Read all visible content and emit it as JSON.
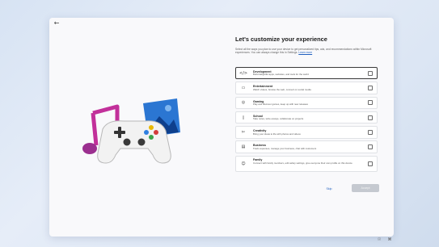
{
  "dialog": {
    "back_icon": "arrow-left-icon",
    "title": "Let's customize your experience",
    "description": "Select all the ways you plan to use your device to get personalized tips, ads, and recommendations within Microsoft experiences. You can always change this in Settings.",
    "learn_more": "Learn more"
  },
  "options": [
    {
      "icon": "code-icon",
      "glyph": "</>",
      "title": "Development",
      "subtitle": "Build delightful apps, websites, and tools for the world",
      "selected": true
    },
    {
      "icon": "tv-icon",
      "glyph": "▭",
      "title": "Entertainment",
      "subtitle": "Watch videos, browse the web, connect on social media",
      "selected": false
    },
    {
      "icon": "gamepad-icon",
      "glyph": "◎",
      "title": "Gaming",
      "subtitle": "Play and discover games, keep up with new releases",
      "selected": false
    },
    {
      "icon": "notebook-icon",
      "glyph": "▯",
      "title": "School",
      "subtitle": "Take notes, write essays, collaborate on projects",
      "selected": false
    },
    {
      "icon": "creativity-icon",
      "glyph": "✄",
      "title": "Creativity",
      "subtitle": "Bring your ideas to life with photos and videos",
      "selected": false
    },
    {
      "icon": "business-icon",
      "glyph": "▤",
      "title": "Business",
      "subtitle": "Track expenses, manage your business, chat with customers",
      "selected": false
    },
    {
      "icon": "family-icon",
      "glyph": "☺",
      "title": "Family",
      "subtitle": "Connect with family members, edit safety settings, give everyone their own profile on this device",
      "selected": false
    }
  ],
  "buttons": {
    "skip": "Skip",
    "accept": "Accept"
  },
  "tray": {
    "icons": [
      "accessibility-icon",
      "network-icon"
    ]
  },
  "colors": {
    "accent": "#1f5fbf",
    "accept_disabled": "#c5c9d0",
    "background": "#dce6f4"
  }
}
